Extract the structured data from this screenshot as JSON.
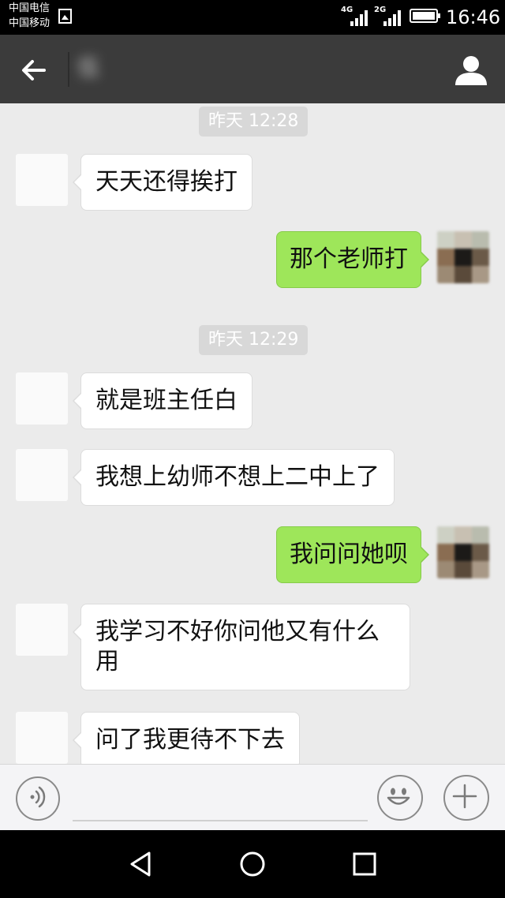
{
  "status_bar": {
    "carrier_1": "中国电信",
    "carrier_2": "中国移动",
    "network_1": "4G",
    "network_2": "2G",
    "time": "16:46"
  },
  "header": {
    "back_icon": "arrow-left-icon",
    "contact_name": "伍",
    "profile_icon": "person-icon"
  },
  "chat": {
    "timestamps": [
      "昨天 12:28",
      "昨天 12:29"
    ],
    "messages": [
      {
        "direction": "incoming",
        "text": "天天还得挨打"
      },
      {
        "direction": "outgoing",
        "text": "那个老师打"
      },
      {
        "direction": "incoming",
        "text": "就是班主任白"
      },
      {
        "direction": "incoming",
        "text": "我想上幼师不想上二中上了"
      },
      {
        "direction": "outgoing",
        "text": "我问问她呗"
      },
      {
        "direction": "incoming",
        "text": "我学习不好你问他又有什么用"
      },
      {
        "direction": "incoming",
        "text": "问了我更待不下去"
      }
    ]
  },
  "input_bar": {
    "voice_icon": "voice-icon",
    "emoji_icon": "smiley-icon",
    "more_icon": "plus-icon"
  },
  "nav_bar": {
    "back_icon": "triangle-back-icon",
    "home_icon": "circle-home-icon",
    "recent_icon": "square-recent-icon"
  },
  "colors": {
    "header_bg": "#3b3b3b",
    "chat_bg": "#ebebeb",
    "outgoing_bubble": "#9ee65a",
    "incoming_bubble": "#ffffff"
  }
}
